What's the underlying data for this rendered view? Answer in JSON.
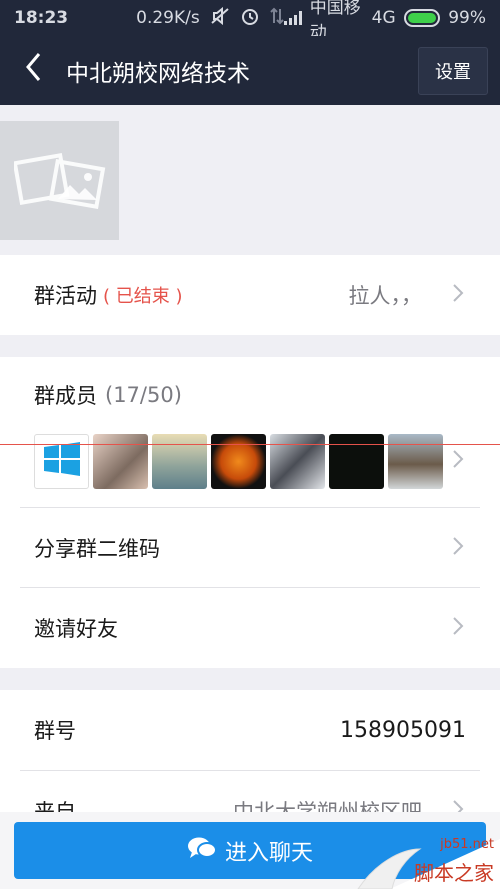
{
  "status_bar": {
    "time": "18:23",
    "speed": "0.29K/s",
    "carrier": "中国移动",
    "network": "4G",
    "battery": "99%"
  },
  "nav": {
    "title": "中北朔校网络技术",
    "settings_label": "设置"
  },
  "activity": {
    "label": "群活动",
    "status": "( 已结束 )",
    "value": "拉人，，",
    "status_color": "#e5534b"
  },
  "members": {
    "label": "群成员",
    "count": "(17/50)"
  },
  "share_qr": {
    "label": "分享群二维码"
  },
  "invite": {
    "label": "邀请好友"
  },
  "group_no": {
    "label": "群号",
    "value": "158905091"
  },
  "from": {
    "label": "来自",
    "value": "中北大学朔州校区吧"
  },
  "enter_chat": {
    "label": "进入聊天"
  },
  "watermark": {
    "site": "jb51.net",
    "name": "脚本之家"
  }
}
